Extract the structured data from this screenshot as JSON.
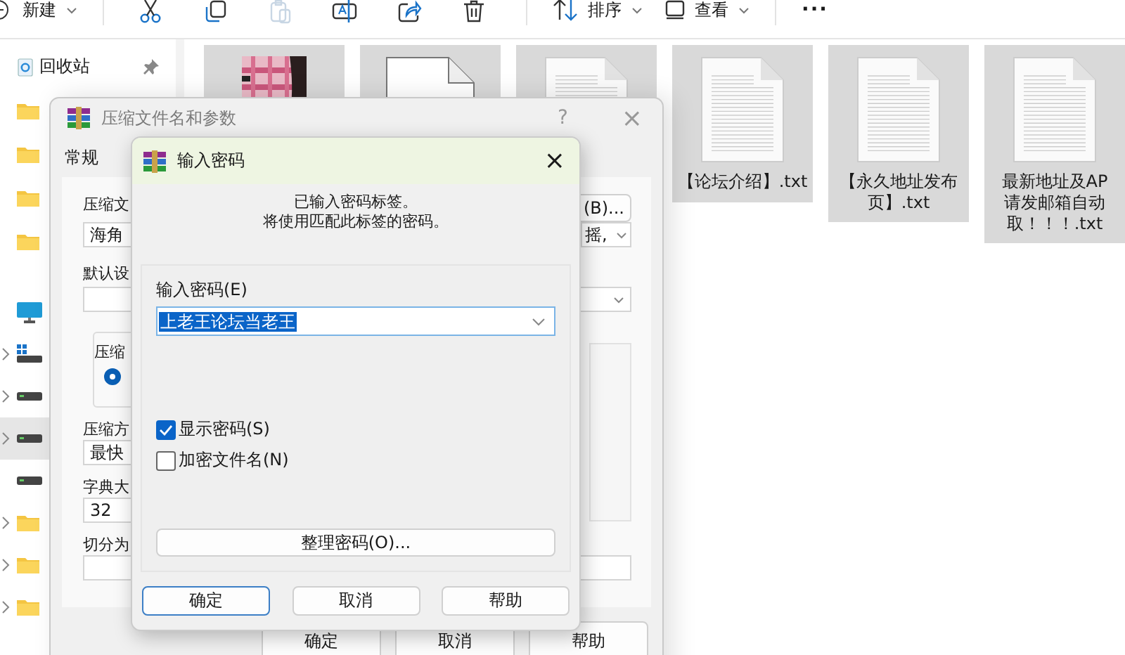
{
  "toolbar": {
    "new_label": "新建",
    "paste_disabled": true,
    "sort_label": "排序",
    "view_label": "查看",
    "more_label": "···"
  },
  "sidebar": {
    "items": [
      {
        "kind": "recycle",
        "label": "回收站",
        "pinned": true,
        "expandable": false,
        "selected": false
      },
      {
        "kind": "folder",
        "pinned": false,
        "expandable": false,
        "selected": false
      },
      {
        "kind": "folder",
        "pinned": false,
        "expandable": false,
        "selected": false
      },
      {
        "kind": "folder",
        "pinned": false,
        "expandable": false,
        "selected": false
      },
      {
        "kind": "folder",
        "pinned": false,
        "expandable": false,
        "selected": false
      },
      {
        "kind": "gap"
      },
      {
        "kind": "pc",
        "pinned": false,
        "expandable": false,
        "selected": false
      },
      {
        "kind": "system-drive",
        "pinned": false,
        "expandable": true,
        "selected": false
      },
      {
        "kind": "drive",
        "pinned": false,
        "expandable": true,
        "selected": false
      },
      {
        "kind": "drive",
        "pinned": false,
        "expandable": true,
        "selected": true
      },
      {
        "kind": "drive",
        "pinned": false,
        "expandable": false,
        "selected": false
      },
      {
        "kind": "folder",
        "pinned": false,
        "expandable": true,
        "selected": false
      },
      {
        "kind": "folder",
        "pinned": false,
        "expandable": true,
        "selected": false
      },
      {
        "kind": "folder",
        "pinned": false,
        "expandable": true,
        "selected": false
      }
    ]
  },
  "files": [
    {
      "kind": "picture",
      "selected": true
    },
    {
      "kind": "blank",
      "selected": true
    },
    {
      "kind": "text",
      "selected": true
    },
    {
      "kind": "text",
      "selected": true,
      "label": "【论坛介绍】.txt"
    },
    {
      "kind": "text",
      "selected": true,
      "label": "【永久地址发布页】.txt"
    },
    {
      "kind": "text",
      "selected": true,
      "label": "最新地址及AP请发邮箱自动取！！！.txt"
    }
  ],
  "archive_dialog": {
    "title": "压缩文件名和参数",
    "help": "?",
    "close": "×",
    "tab": "常规",
    "archive_label": "压缩文",
    "archive_value": "海角",
    "browse_button": "(B)...",
    "mode_value": "摇,",
    "profile_label": "默认设",
    "format_group": "压缩",
    "format_option": {
      "selected": true
    },
    "method_label": "压缩方",
    "method_value": "最快",
    "dict_label": "字典大",
    "dict_value": "32",
    "split_label": "切分为",
    "buttons": [
      "确定",
      "取消",
      "帮助"
    ]
  },
  "password_dialog": {
    "title": "输入密码",
    "close": "×",
    "message": [
      "已输入密码标签。",
      "将使用匹配此标签的密码。"
    ],
    "password_label": "输入密码(E)",
    "password_value": "上老王论坛当老王",
    "value_selected": true,
    "options": [
      {
        "label": "显示密码(S)",
        "checked": true
      },
      {
        "label": "加密文件名(N)",
        "checked": false
      }
    ],
    "organize_button": "整理密码(O)...",
    "buttons": [
      {
        "label": "确定",
        "default": true
      },
      {
        "label": "取消",
        "default": false
      },
      {
        "label": "帮助",
        "default": false
      }
    ]
  }
}
